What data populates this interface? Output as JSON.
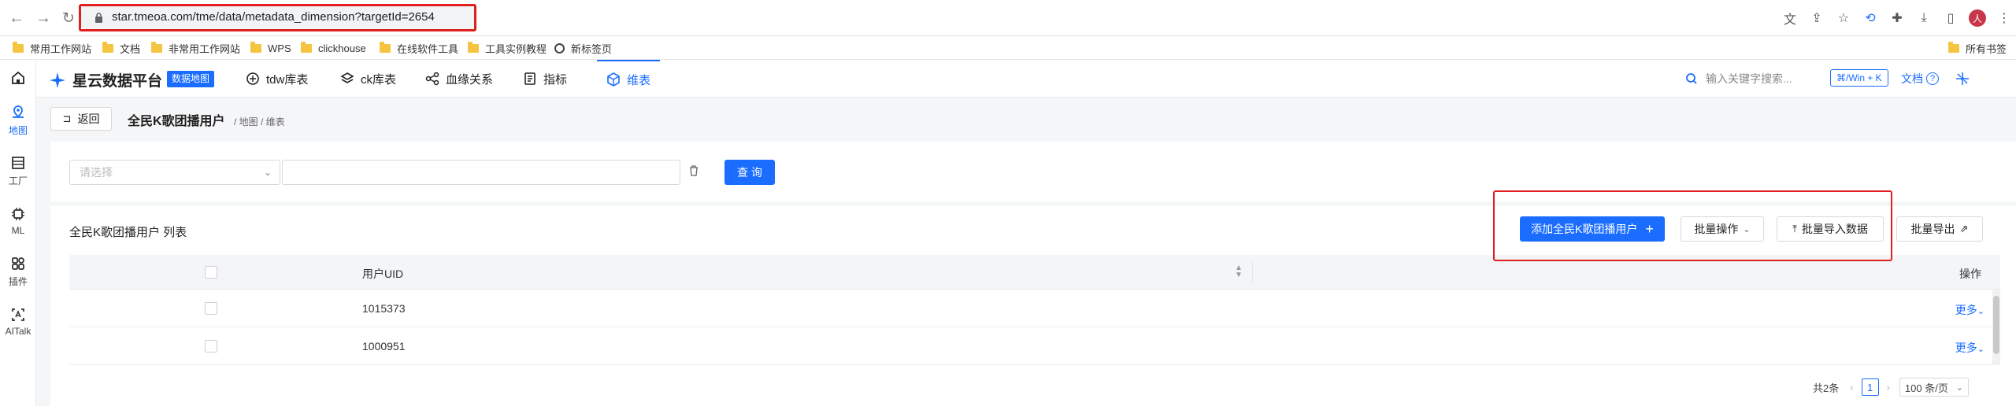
{
  "browser": {
    "url": "star.tmeoa.com/tme/data/metadata_dimension?targetId=2654",
    "profile_initial": "人"
  },
  "bookmarks": [
    {
      "label": "常用工作网站",
      "icon": "folder-icon"
    },
    {
      "label": "文档",
      "icon": "folder-icon"
    },
    {
      "label": "非常用工作网站",
      "icon": "folder-icon"
    },
    {
      "label": "WPS",
      "icon": "folder-icon"
    },
    {
      "label": "clickhouse",
      "icon": "folder-icon"
    },
    {
      "label": "在线软件工具",
      "icon": "folder-icon"
    },
    {
      "label": "工具实例教程",
      "icon": "folder-icon"
    },
    {
      "label": "新标签页",
      "icon": "globe-icon"
    },
    {
      "label": "所有书签",
      "icon": "folder-icon"
    }
  ],
  "rail": {
    "items": [
      {
        "label": "",
        "icon": "home-icon"
      },
      {
        "label": "地图",
        "icon": "map-icon",
        "active": true
      },
      {
        "label": "工厂",
        "icon": "factory-icon"
      },
      {
        "label": "ML",
        "icon": "chip-icon"
      },
      {
        "label": "插件",
        "icon": "plugin-icon"
      },
      {
        "label": "AITalk",
        "icon": "ai-icon"
      }
    ]
  },
  "app": {
    "name": "星云数据平台",
    "badge": "数据地图",
    "menu": [
      {
        "label": "tdw库表",
        "icon": "tdw-icon"
      },
      {
        "label": "ck库表",
        "icon": "ck-icon"
      },
      {
        "label": "血缘关系",
        "icon": "lineage-icon"
      },
      {
        "label": "指标",
        "icon": "metric-icon"
      },
      {
        "label": "维表",
        "icon": "dimension-icon",
        "active": true
      }
    ],
    "search_placeholder": "输入关键字搜索...",
    "shortcut": "⌘/Win + K",
    "doc_label": "文档",
    "accent": "#1a6dff"
  },
  "page": {
    "back_label": "返回",
    "title": "全民K歌团播用户",
    "breadcrumb": "/ 地图 / 维表"
  },
  "filter": {
    "select_placeholder": "请选择",
    "query_label": "查 询"
  },
  "list": {
    "title": "全民K歌团播用户 列表",
    "add_label": "添加全民K歌团播用户",
    "batch_ops_label": "批量操作",
    "batch_import_label": "批量导入数据",
    "batch_export_label": "批量导出",
    "columns": {
      "uid": "用户UID",
      "ops": "操作"
    },
    "rows": [
      {
        "uid": "1015373",
        "more": "更多"
      },
      {
        "uid": "1000951",
        "more": "更多"
      }
    ]
  },
  "pagination": {
    "total": "共2条",
    "current": "1",
    "page_size": "100 条/页"
  }
}
